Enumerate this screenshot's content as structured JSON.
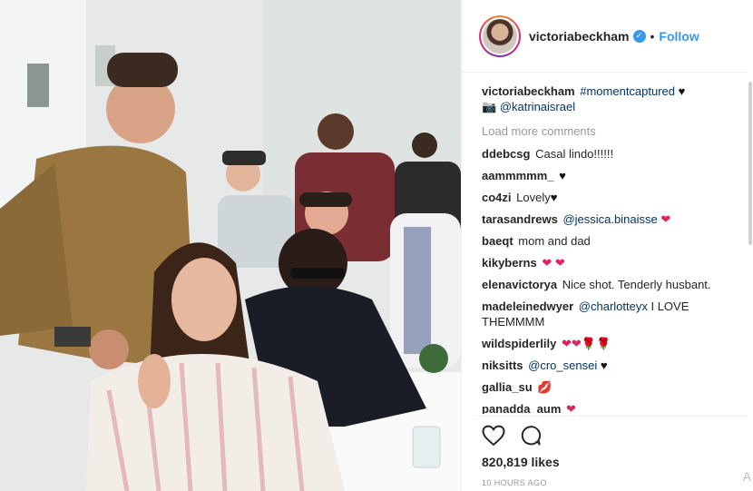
{
  "header": {
    "username": "victoriabeckham",
    "separator": "•",
    "follow_label": "Follow"
  },
  "caption": {
    "username": "victoriabeckham",
    "hashtag": "#momentcaptured",
    "emoji": "♥",
    "camera": "📷",
    "mention": "@katrinaisrael"
  },
  "load_more": "Load more comments",
  "comments": [
    {
      "user": "ddebcsg",
      "text": "Casal lindo!!!!!!",
      "mention": "",
      "emoji": ""
    },
    {
      "user": "aammmmm_",
      "text": "",
      "mention": "",
      "emoji": "♥"
    },
    {
      "user": "co4zi",
      "text": "Lovely",
      "mention": "",
      "emoji": "♥"
    },
    {
      "user": "tarasandrews",
      "text": "",
      "mention": "@jessica.binaisse",
      "emoji": "❤"
    },
    {
      "user": "baeqt",
      "text": "mom and dad",
      "mention": "",
      "emoji": ""
    },
    {
      "user": "kikyberns",
      "text": "",
      "mention": "",
      "emoji": "❤ ❤"
    },
    {
      "user": "elenavictorya",
      "text": "Nice shot. Tenderly husbant.",
      "mention": "",
      "emoji": ""
    },
    {
      "user": "madeleinedwyer",
      "text": "I LOVE THEMMMM",
      "mention": "@charlotteyx",
      "emoji": ""
    },
    {
      "user": "wildspiderlily",
      "text": "",
      "mention": "",
      "emoji": "❤❤🌹🌹"
    },
    {
      "user": "niksitts",
      "text": "",
      "mention": "@cro_sensei",
      "emoji": "♥"
    },
    {
      "user": "gallia_su",
      "text": "",
      "mention": "",
      "emoji": "💋"
    },
    {
      "user": "panadda_aum",
      "text": "",
      "mention": "",
      "emoji": "❤"
    }
  ],
  "likes": "820,819 likes",
  "time": "10 HOURS AGO",
  "corner_glyph": "A",
  "colors": {
    "link": "#3897f0",
    "mention": "#003569",
    "heart": "#e0245e"
  }
}
